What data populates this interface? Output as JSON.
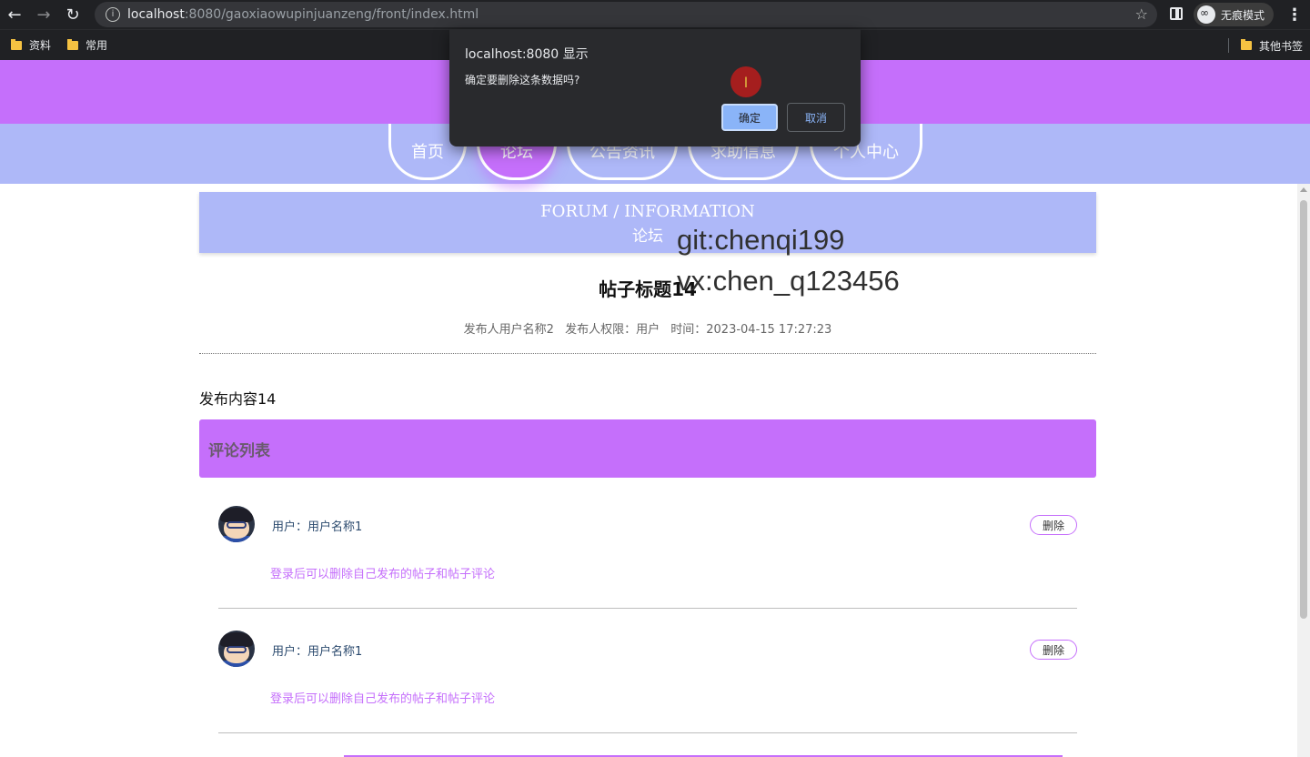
{
  "browser": {
    "url_host": "localhost",
    "url_rest": ":8080/gaoxiaowupinjuanzeng/front/index.html",
    "incognito_label": "无痕模式",
    "bookmarks": [
      "资料",
      "常用"
    ],
    "other_bookmarks": "其他书签"
  },
  "nav": {
    "items": [
      {
        "label": "首页",
        "active": false
      },
      {
        "label": "论坛",
        "active": true
      },
      {
        "label": "公告资讯",
        "active": false
      },
      {
        "label": "求助信息",
        "active": false
      },
      {
        "label": "个人中心",
        "active": false
      }
    ]
  },
  "banner": {
    "en": "FORUM / INFORMATION",
    "cn": "论坛"
  },
  "watermark": {
    "line1": "git:chenqi199",
    "line2": "vx:chen_q123456"
  },
  "post": {
    "title": "帖子标题14",
    "author": "发布人用户名称2",
    "role": "发布人权限：用户",
    "time": "时间：2023-04-15 17:27:23",
    "content": "发布内容14"
  },
  "comments": {
    "header": "评论列表",
    "items": [
      {
        "user": "用户：用户名称1",
        "text": "登录后可以删除自己发布的帖子和帖子评论",
        "delete_label": "删除"
      },
      {
        "user": "用户：用户名称1",
        "text": "登录后可以删除自己发布的帖子和帖子评论",
        "delete_label": "删除"
      }
    ]
  },
  "dialog": {
    "title": "localhost:8080 显示",
    "message": "确定要删除这条数据吗?",
    "ok_label": "确定",
    "cancel_label": "取消"
  },
  "colors": {
    "accent_purple": "#c56ffb",
    "nav_blue": "#aeb8f8"
  }
}
